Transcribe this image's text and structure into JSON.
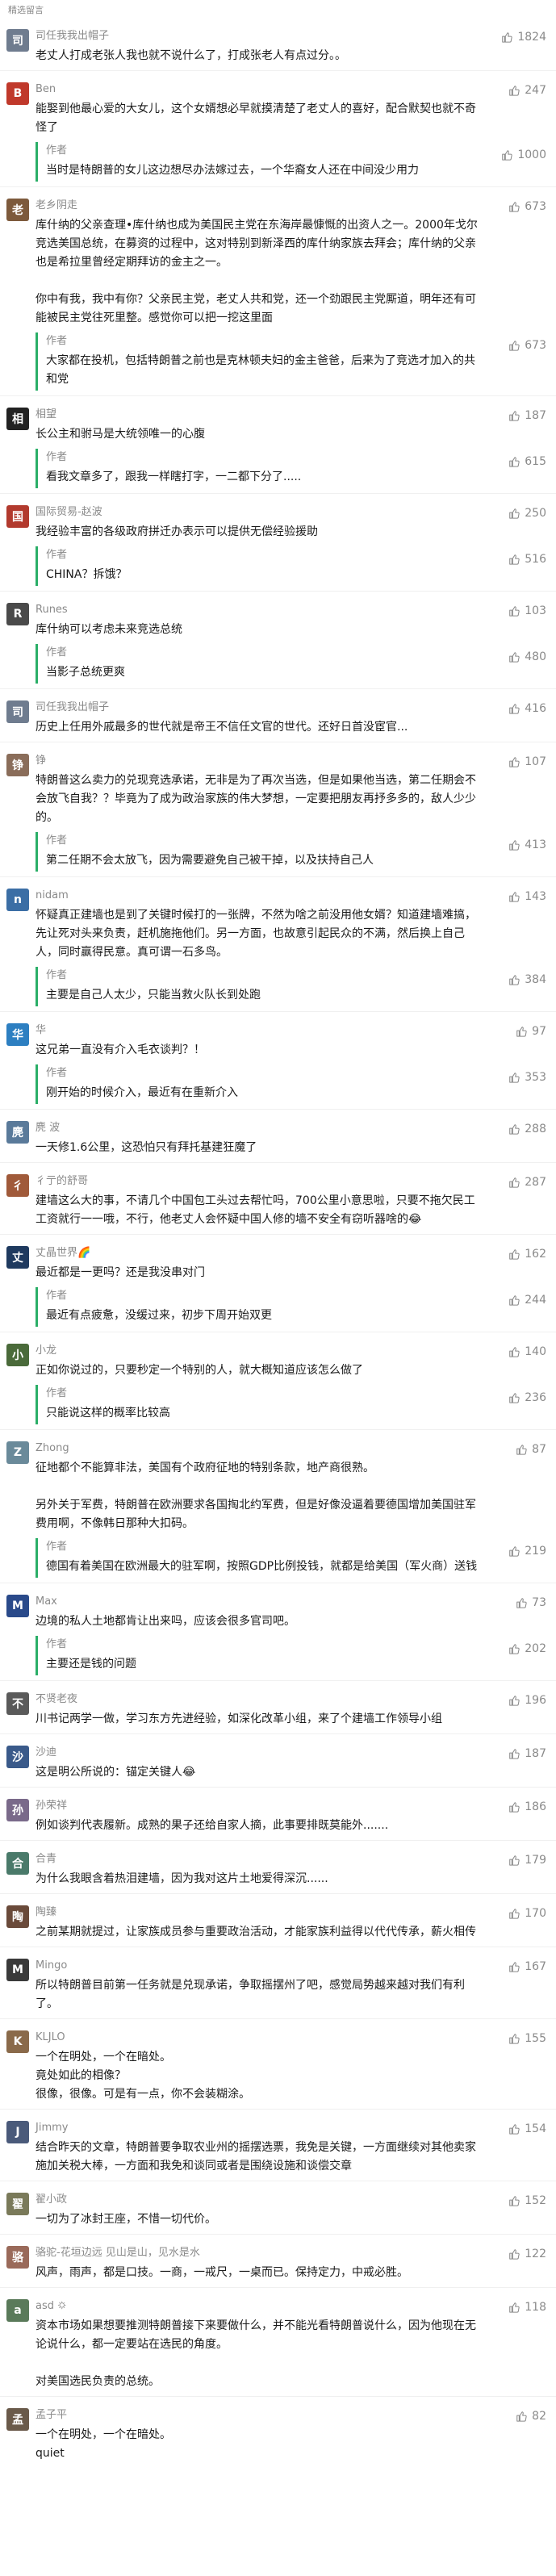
{
  "section_title": "精选留言",
  "author_label": "作者",
  "comments": [
    {
      "name": "司任我我出帽子",
      "avatar_color": "#6f7c8f",
      "avatar_char": "司",
      "likes": "1824",
      "text": "老丈人打成老张人我也就不说什么了，打成张老人有点过分。。",
      "reply": null
    },
    {
      "name": "Ben",
      "avatar_color": "#c0392b",
      "avatar_char": "B",
      "likes": "247",
      "text": "能娶到他最心爱的大女儿，这个女婿想必早就摸清楚了老丈人的喜好，配合默契也就不奇怪了",
      "reply": {
        "likes": "1000",
        "text": "当时是特朗普的女儿这边想尽办法嫁过去，一个华裔女人还在中间没少用力"
      }
    },
    {
      "name": "老乡阴走",
      "avatar_color": "#7d5a3c",
      "avatar_char": "老",
      "likes": "673",
      "text": "库什纳的父亲查理•库什纳也成为美国民主党在东海岸最慷慨的出资人之一。2000年戈尔竞选美国总统，在募资的过程中，这对特别到新泽西的库什纳家族去拜会；库什纳的父亲也是希拉里曾经定期拜访的金主之一。\n\n你中有我，我中有你？父亲民主党，老丈人共和党，还一个劲跟民主党厮道，明年还有可能被民主党往死里整。感觉你可以把一挖这里面",
      "reply": {
        "likes": "673",
        "text": "大家都在投机，包括特朗普之前也是克林顿夫妇的金主爸爸，后来为了竞选才加入的共和党"
      }
    },
    {
      "name": "相望",
      "avatar_color": "#222222",
      "avatar_char": "相",
      "likes": "187",
      "text": "长公主和驸马是大统领唯一的心腹",
      "reply": {
        "likes": "615",
        "text": "看我文章多了，跟我一样瞎打字，一二都下分了....."
      }
    },
    {
      "name": "国际贸易-赵波",
      "avatar_color": "#b23a2e",
      "avatar_char": "国",
      "likes": "250",
      "text": "我经验丰富的各级政府拼迁办表示可以提供无偿经验援助",
      "reply": {
        "likes": "516",
        "text": "CHINA？拆饿？"
      }
    },
    {
      "name": "Runes",
      "avatar_color": "#4a4a4a",
      "avatar_char": "R",
      "likes": "103",
      "text": "库什纳可以考虑未来竞选总统",
      "reply": {
        "likes": "480",
        "text": "当影子总统更爽"
      }
    },
    {
      "name": "司任我我出帽子",
      "avatar_color": "#6f7c8f",
      "avatar_char": "司",
      "likes": "416",
      "text": "历史上任用外戚最多的世代就是帝王不信任文官的世代。还好日首没宦官...",
      "reply": null
    },
    {
      "name": "铮",
      "avatar_color": "#8a6d5a",
      "avatar_char": "铮",
      "likes": "107",
      "text": "特朗普这么卖力的兑现竞选承诺，无非是为了再次当选，但是如果他当选，第二任期会不会放飞自我？？毕竟为了成为政治家族的伟大梦想，一定要把朋友再抒多多的，敌人少少的。",
      "reply": {
        "likes": "413",
        "text": "第二任期不会太放飞，因为需要避免自己被干掉，以及扶持自己人"
      }
    },
    {
      "name": "nidam",
      "avatar_color": "#3b6ea5",
      "avatar_char": "n",
      "likes": "143",
      "text": "怀疑真正建墙也是到了关键时候打的一张牌，不然为啥之前没用他女婿？知道建墙难搞，先让死对头来负责，赶机施拖他们。另一方面，也故意引起民众的不满，然后换上自己人，同时赢得民意。真可谓一石多鸟。",
      "reply": {
        "likes": "384",
        "text": "主要是自己人太少，只能当救火队长到处跑"
      }
    },
    {
      "name": "华",
      "avatar_color": "#2d7fc1",
      "avatar_char": "华",
      "likes": "97",
      "text": "这兄弟一直没有介入毛衣谈判？！",
      "reply": {
        "likes": "353",
        "text": "刚开始的时候介入，最近有在重新介入"
      }
    },
    {
      "name": "麂 波",
      "avatar_color": "#5a7a9a",
      "avatar_char": "麂",
      "likes": "288",
      "text": "一天修1.6公里，这恐怕只有拜托基建狂魔了",
      "reply": null
    },
    {
      "name": "彳亍的舒哥",
      "avatar_color": "#a05a3a",
      "avatar_char": "彳",
      "likes": "287",
      "text": "建墙这么大的事，不请几个中国包工头过去帮忙吗，700公里小意思啦，只要不拖欠民工工资就行一一哦，不行，他老丈人会怀疑中国人修的墙不安全有窃听器啥的😂",
      "reply": null
    },
    {
      "name": "丈晶世界🌈",
      "avatar_color": "#1f3a5f",
      "avatar_char": "丈",
      "likes": "162",
      "text": "最近都是一更吗？还是我没串对门",
      "reply": {
        "likes": "244",
        "text": "最近有点疲惫，没缓过来，初步下周开始双更"
      }
    },
    {
      "name": "小龙",
      "avatar_color": "#4a6a3a",
      "avatar_char": "小",
      "likes": "140",
      "text": "正如你说过的，只要秒定一个特别的人，就大概知道应该怎么做了",
      "reply": {
        "likes": "236",
        "text": "只能说这样的概率比较高"
      }
    },
    {
      "name": "Zhong",
      "avatar_color": "#6a8a9a",
      "avatar_char": "Z",
      "likes": "87",
      "text": "征地都个不能算非法，美国有个政府征地的特别条款，地产商很熟。\n\n另外关于军费，特朗普在欧洲要求各国掏北约军费，但是好像没逼着要德国增加美国驻军费用啊，不像韩日那种大扣码。",
      "reply": {
        "likes": "219",
        "text": "德国有着美国在欧洲最大的驻军啊，按照GDP比例投钱，就都是给美国（军火商）送钱"
      }
    },
    {
      "name": "Max",
      "avatar_color": "#2a4a8a",
      "avatar_char": "M",
      "likes": "73",
      "text": "边境的私人土地都肯让出来吗，应该会很多官司吧。",
      "reply": {
        "likes": "202",
        "text": "主要还是钱的问题"
      }
    },
    {
      "name": "不贤老夜",
      "avatar_color": "#5a5a5a",
      "avatar_char": "不",
      "likes": "196",
      "text": "川书记两学一做，学习东方先进经验，如深化改革小组，来了个建墙工作领导小组",
      "reply": null
    },
    {
      "name": "沙迪",
      "avatar_color": "#3a5a8a",
      "avatar_char": "沙",
      "likes": "187",
      "text": "这是明公所说的：锚定关键人😂",
      "reply": null
    },
    {
      "name": "孙荣祥",
      "avatar_color": "#7a6a8a",
      "avatar_char": "孙",
      "likes": "186",
      "text": "例如谈判代表履新。成熟的果子还给自家人摘，此事要排既莫能外.......",
      "reply": null
    },
    {
      "name": "合青",
      "avatar_color": "#4a7a6a",
      "avatar_char": "合",
      "likes": "179",
      "text": "为什么我眼含着热泪建墙，因为我对这片土地爱得深沉......",
      "reply": null
    },
    {
      "name": "陶臻",
      "avatar_color": "#6a4a3a",
      "avatar_char": "陶",
      "likes": "170",
      "text": "之前某期就提过，让家族成员参与重要政治活动，才能家族利益得以代代传承，薪火相传",
      "reply": null
    },
    {
      "name": "Mingo",
      "avatar_color": "#3a3a3a",
      "avatar_char": "M",
      "likes": "167",
      "text": "所以特朗普目前第一任务就是兑现承诺，争取摇摆州了吧，感觉局势越来越对我们有利了。",
      "reply": null
    },
    {
      "name": "KLJLO",
      "avatar_color": "#8a6a4a",
      "avatar_char": "K",
      "likes": "155",
      "text": "一个在明处，一个在暗处。\n竟处如此的相像？\n很像，很像。可是有一点，你不会装糊涂。",
      "reply": null
    },
    {
      "name": "Jimmy",
      "avatar_color": "#4a5a7a",
      "avatar_char": "J",
      "likes": "154",
      "text": "结合昨天的文章，特朗普要争取农业州的摇摆选票，我免是关键，一方面继续对其他卖家施加关税大棒，一方面和我免和谈同或者是围绕设施和谈偿交章",
      "reply": null
    },
    {
      "name": "翟小政",
      "avatar_color": "#7a7a5a",
      "avatar_char": "翟",
      "likes": "152",
      "text": "一切为了冰封王座，不惜一切代价。",
      "reply": null
    },
    {
      "name": "骆驼-花垣边远 见山是山，见水是水",
      "avatar_color": "#9a6a5a",
      "avatar_char": "骆",
      "likes": "122",
      "text": "风声，雨声，都是口技。一商，一戒尺，一桌而已。保持定力，中戒必胜。",
      "reply": null
    },
    {
      "name": "asd 🌣",
      "avatar_color": "#5a7a5a",
      "avatar_char": "a",
      "likes": "118",
      "text": "资本市场如果想要推测特朗普接下来要做什么，并不能光看特朗普说什么，因为他现在无论说什么，都一定要站在选民的角度。\n\n对美国选民负责的总统。",
      "reply": null
    },
    {
      "name": "孟子平",
      "avatar_color": "#6a5a4a",
      "avatar_char": "孟",
      "likes": "82",
      "text": "一个在明处，一个在暗处。\nquiet",
      "reply": null
    }
  ]
}
